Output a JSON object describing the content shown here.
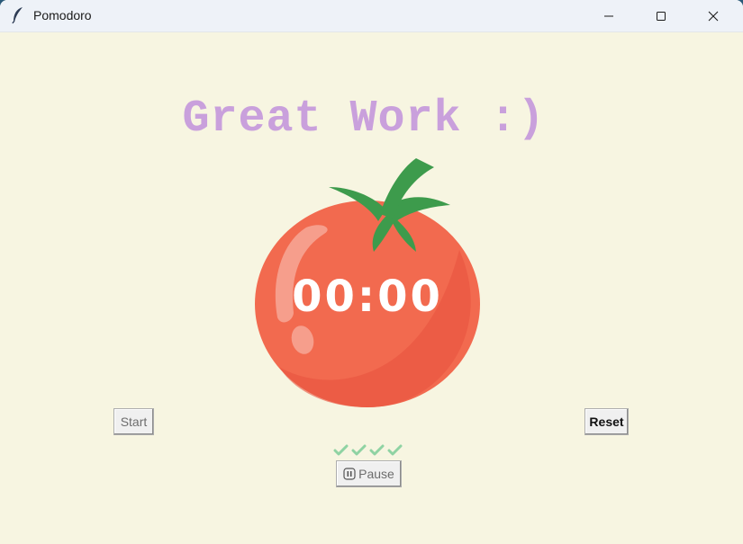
{
  "window": {
    "title": "Pomodoro",
    "icon": "feather-icon",
    "controls": [
      "minimize-icon",
      "maximize-icon",
      "close-icon"
    ]
  },
  "headline": "Great Work :)",
  "timer": {
    "display": "00:00",
    "image": "tomato-icon"
  },
  "buttons": {
    "start_label": "Start",
    "reset_label": "Reset",
    "pause_label": "Pause",
    "start_enabled": false,
    "pause_enabled": false
  },
  "checkmarks": {
    "count": 4,
    "symbol": "✔",
    "color": "#8fd3a3"
  },
  "colors": {
    "background": "#f7f5e1",
    "headline": "#c9a0dc",
    "tomato": "#f26a4f",
    "leaf": "#3d9b4c"
  }
}
